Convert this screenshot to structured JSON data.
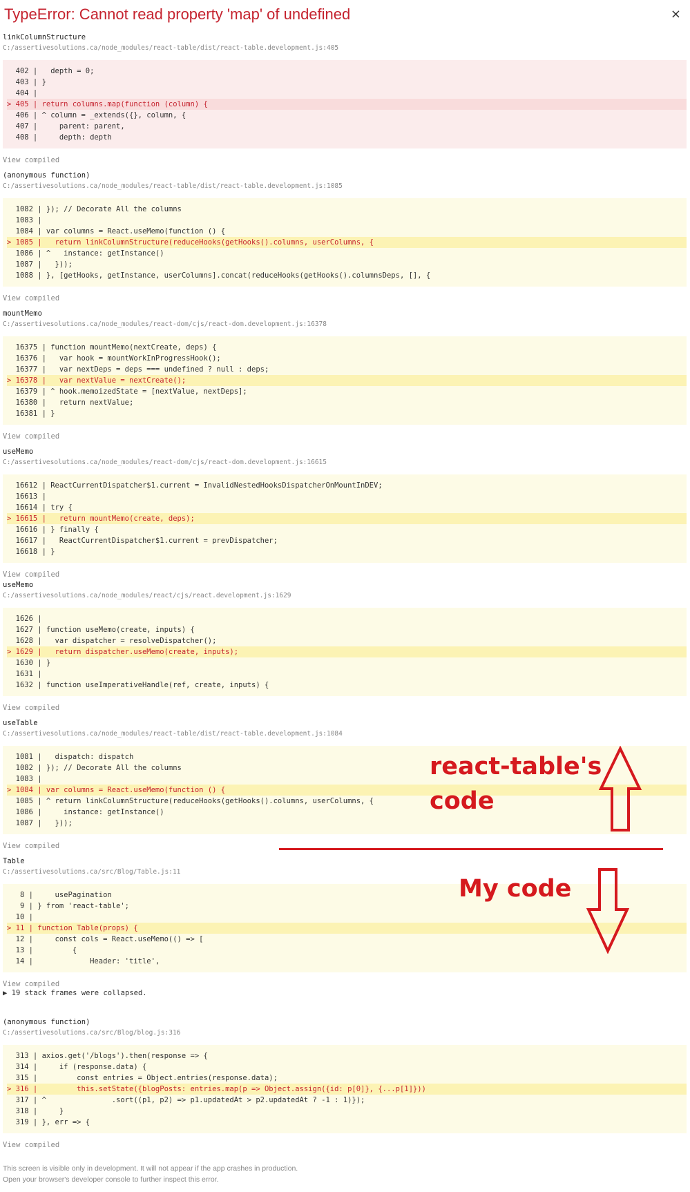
{
  "header": {
    "title": "TypeError: Cannot read property 'map' of undefined",
    "close_label": "×"
  },
  "frames": [
    {
      "fn": "linkColumnStructure",
      "file": "C:/assertivesolutions.ca/node_modules/react-table/dist/react-table.development.js:405",
      "error": true,
      "lines": [
        {
          "text": "  402 |   depth = 0;",
          "hl": false
        },
        {
          "text": "  403 | }",
          "hl": false
        },
        {
          "text": "  404 |",
          "hl": false
        },
        {
          "text": "> 405 | return columns.map(function (column) {",
          "hl": true
        },
        {
          "text": "  406 | ^ column = _extends({}, column, {",
          "hl": false
        },
        {
          "text": "  407 |     parent: parent,",
          "hl": false
        },
        {
          "text": "  408 |     depth: depth",
          "hl": false
        }
      ],
      "view_label": "View compiled"
    },
    {
      "fn": "(anonymous function)",
      "file": "C:/assertivesolutions.ca/node_modules/react-table/dist/react-table.development.js:1085",
      "error": false,
      "lines": [
        {
          "text": "  1082 | }); // Decorate All the columns",
          "hl": false
        },
        {
          "text": "  1083 |",
          "hl": false
        },
        {
          "text": "  1084 | var columns = React.useMemo(function () {",
          "hl": false
        },
        {
          "text": "> 1085 |   return linkColumnStructure(reduceHooks(getHooks().columns, userColumns, {",
          "hl": true
        },
        {
          "text": "  1086 | ^   instance: getInstance()",
          "hl": false
        },
        {
          "text": "  1087 |   }));",
          "hl": false
        },
        {
          "text": "  1088 | }, [getHooks, getInstance, userColumns].concat(reduceHooks(getHooks().columnsDeps, [], {",
          "hl": false
        }
      ],
      "view_label": "View compiled"
    },
    {
      "fn": "mountMemo",
      "file": "C:/assertivesolutions.ca/node_modules/react-dom/cjs/react-dom.development.js:16378",
      "error": false,
      "lines": [
        {
          "text": "  16375 | function mountMemo(nextCreate, deps) {",
          "hl": false
        },
        {
          "text": "  16376 |   var hook = mountWorkInProgressHook();",
          "hl": false
        },
        {
          "text": "  16377 |   var nextDeps = deps === undefined ? null : deps;",
          "hl": false
        },
        {
          "text": "> 16378 |   var nextValue = nextCreate();",
          "hl": true
        },
        {
          "text": "  16379 | ^ hook.memoizedState = [nextValue, nextDeps];",
          "hl": false
        },
        {
          "text": "  16380 |   return nextValue;",
          "hl": false
        },
        {
          "text": "  16381 | }",
          "hl": false
        }
      ],
      "view_label": "View compiled"
    },
    {
      "fn": "useMemo",
      "file": "C:/assertivesolutions.ca/node_modules/react-dom/cjs/react-dom.development.js:16615",
      "error": false,
      "lines": [
        {
          "text": "  16612 | ReactCurrentDispatcher$1.current = InvalidNestedHooksDispatcherOnMountInDEV;",
          "hl": false
        },
        {
          "text": "  16613 |",
          "hl": false
        },
        {
          "text": "  16614 | try {",
          "hl": false
        },
        {
          "text": "> 16615 |   return mountMemo(create, deps);",
          "hl": true
        },
        {
          "text": "  16616 | } finally {",
          "hl": false
        },
        {
          "text": "  16617 |   ReactCurrentDispatcher$1.current = prevDispatcher;",
          "hl": false
        },
        {
          "text": "  16618 | }",
          "hl": false
        }
      ],
      "view_label": "View compiled"
    },
    {
      "fn": "useMemo",
      "file": "C:/assertivesolutions.ca/node_modules/react/cjs/react.development.js:1629",
      "error": false,
      "lines": [
        {
          "text": "  1626 |",
          "hl": false
        },
        {
          "text": "  1627 | function useMemo(create, inputs) {",
          "hl": false
        },
        {
          "text": "  1628 |   var dispatcher = resolveDispatcher();",
          "hl": false
        },
        {
          "text": "> 1629 |   return dispatcher.useMemo(create, inputs);",
          "hl": true
        },
        {
          "text": "  1630 | }",
          "hl": false
        },
        {
          "text": "  1631 |",
          "hl": false
        },
        {
          "text": "  1632 | function useImperativeHandle(ref, create, inputs) {",
          "hl": false
        }
      ],
      "view_label": "View compiled"
    },
    {
      "fn": "useTable",
      "file": "C:/assertivesolutions.ca/node_modules/react-table/dist/react-table.development.js:1084",
      "error": false,
      "lines": [
        {
          "text": "  1081 |   dispatch: dispatch",
          "hl": false
        },
        {
          "text": "  1082 | }); // Decorate All the columns",
          "hl": false
        },
        {
          "text": "  1083 |",
          "hl": false
        },
        {
          "text": "> 1084 | var columns = React.useMemo(function () {",
          "hl": true
        },
        {
          "text": "  1085 | ^ return linkColumnStructure(reduceHooks(getHooks().columns, userColumns, {",
          "hl": false
        },
        {
          "text": "  1086 |     instance: getInstance()",
          "hl": false
        },
        {
          "text": "  1087 |   }));",
          "hl": false
        }
      ],
      "view_label": "View compiled"
    },
    {
      "fn": "Table",
      "file": "C:/assertivesolutions.ca/src/Blog/Table.js:11",
      "error": false,
      "lines": [
        {
          "text": "   8 |     usePagination",
          "hl": false
        },
        {
          "text": "   9 | } from 'react-table';",
          "hl": false
        },
        {
          "text": "  10 |",
          "hl": false
        },
        {
          "text": "> 11 | function Table(props) {",
          "hl": true
        },
        {
          "text": "  12 |     const cols = React.useMemo(() => [",
          "hl": false
        },
        {
          "text": "  13 |         {",
          "hl": false
        },
        {
          "text": "  14 |             Header: 'title',",
          "hl": false
        }
      ],
      "view_label": "View compiled"
    },
    {
      "fn": "(anonymous function)",
      "file": "C:/assertivesolutions.ca/src/Blog/blog.js:316",
      "error": false,
      "lines": [
        {
          "text": "  313 | axios.get('/blogs').then(response => {",
          "hl": false
        },
        {
          "text": "  314 |     if (response.data) {",
          "hl": false
        },
        {
          "text": "  315 |         const entries = Object.entries(response.data);",
          "hl": false
        },
        {
          "text": "> 316 |         this.setState({blogPosts: entries.map(p => Object.assign({id: p[0]}, {...p[1]}))",
          "hl": true
        },
        {
          "text": "  317 | ^               .sort((p1, p2) => p1.updatedAt > p2.updatedAt ? -1 : 1)});",
          "hl": false
        },
        {
          "text": "  318 |     }",
          "hl": false
        },
        {
          "text": "  319 | }, err => {",
          "hl": false
        }
      ],
      "view_label": "View compiled"
    }
  ],
  "collapsed_label": "▶ 19 stack frames were collapsed.",
  "footer": {
    "line1": "This screen is visible only in development. It will not appear if the app crashes in production.",
    "line2": "Open your browser's developer console to further inspect this error."
  },
  "annotations": {
    "upper_line1": "react-table's",
    "upper_line2": "code",
    "lower": "My code",
    "color": "#d5191e"
  },
  "icons": {
    "close": "close-icon",
    "up": "up-arrow-icon",
    "down": "down-arrow-icon"
  }
}
